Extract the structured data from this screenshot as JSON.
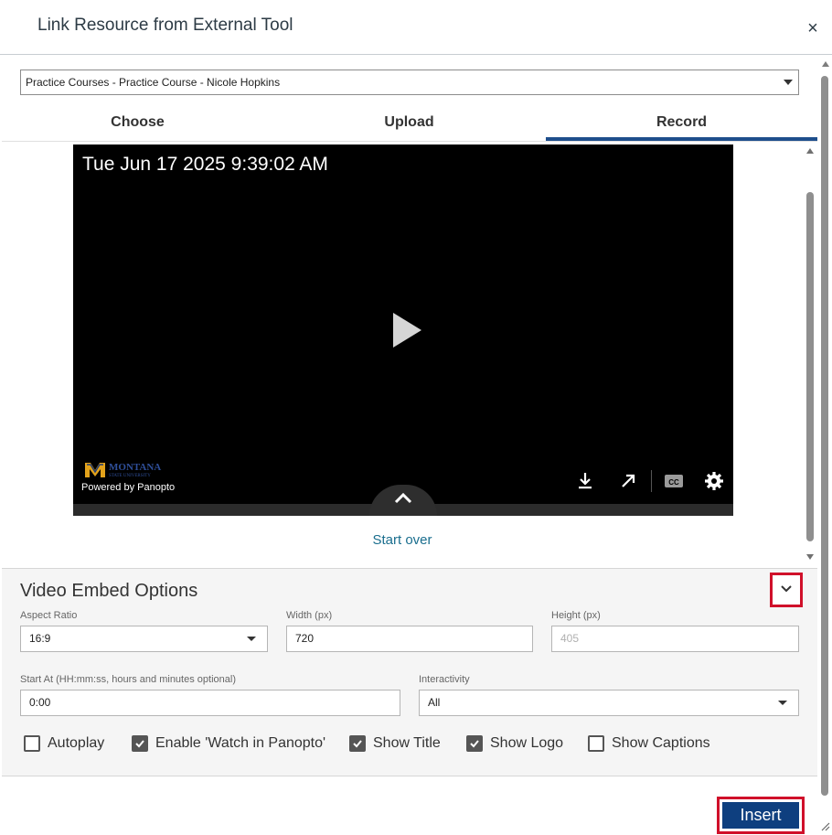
{
  "dialog": {
    "title": "Link Resource from External Tool",
    "close_label": "×"
  },
  "folder_select": {
    "value": "Practice Courses - Practice Course - Nicole Hopkins"
  },
  "tabs": [
    {
      "label": "Choose",
      "active": false
    },
    {
      "label": "Upload",
      "active": false
    },
    {
      "label": "Record",
      "active": true
    }
  ],
  "player": {
    "timestamp": "Tue Jun 17 2025 9:39:02 AM",
    "logo_text": "MONTANA",
    "logo_subtext": "STATE UNIVERSITY",
    "powered_by": "Powered by Panopto",
    "controls": [
      "download-icon",
      "open-external-icon",
      "closed-captions-icon",
      "settings-gear-icon"
    ]
  },
  "start_over_label": "Start over",
  "embed_options": {
    "title": "Video Embed Options",
    "aspect_ratio": {
      "label": "Aspect Ratio",
      "value": "16:9"
    },
    "width": {
      "label": "Width (px)",
      "value": "720"
    },
    "height": {
      "label": "Height (px)",
      "placeholder": "405"
    },
    "start_at": {
      "label": "Start At (HH:mm:ss, hours and minutes optional)",
      "value": "0:00"
    },
    "interactivity": {
      "label": "Interactivity",
      "value": "All"
    },
    "checkboxes": [
      {
        "label": "Autoplay",
        "checked": false
      },
      {
        "label": "Enable 'Watch in Panopto'",
        "checked": true
      },
      {
        "label": "Show Title",
        "checked": true
      },
      {
        "label": "Show Logo",
        "checked": true
      },
      {
        "label": "Show Captions",
        "checked": false
      }
    ]
  },
  "insert_label": "Insert",
  "colors": {
    "accent_blue": "#0e3f7f",
    "tab_underline": "#1e4e8c",
    "link": "#1a6e8e",
    "highlight_red": "#d0102a"
  }
}
